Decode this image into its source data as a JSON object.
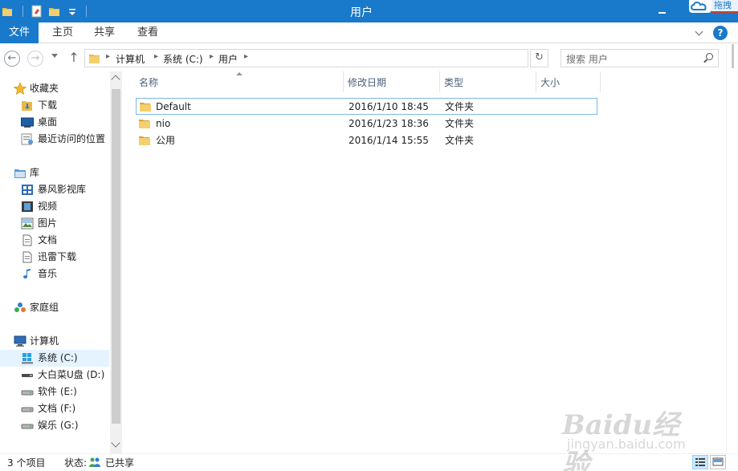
{
  "window": {
    "title": "用户",
    "overlay_button": "拖拽"
  },
  "ribbon": {
    "tabs": [
      "文件",
      "主页",
      "共享",
      "查看"
    ],
    "help": "?"
  },
  "nav": {
    "breadcrumb": [
      "计算机",
      "系统 (C:)",
      "用户"
    ],
    "search_placeholder": "搜索 用户"
  },
  "sidebar": {
    "favorites_header": "收藏夹",
    "favorites": [
      "下载",
      "桌面",
      "最近访问的位置"
    ],
    "libraries_header": "库",
    "libraries": [
      "暴风影视库",
      "视频",
      "图片",
      "文档",
      "迅雷下载",
      "音乐"
    ],
    "homegroup": "家庭组",
    "computer_header": "计算机",
    "drives": [
      "系统 (C:)",
      "大白菜U盘 (D:)",
      "软件 (E:)",
      "文档 (F:)",
      "娱乐 (G:)"
    ]
  },
  "columns": [
    "名称",
    "修改日期",
    "类型",
    "大小"
  ],
  "files": [
    {
      "name": "Default",
      "date": "2016/1/10 18:45",
      "type": "文件夹",
      "size": ""
    },
    {
      "name": "nio",
      "date": "2016/1/23 18:36",
      "type": "文件夹",
      "size": ""
    },
    {
      "name": "公用",
      "date": "2016/1/14 15:55",
      "type": "文件夹",
      "size": ""
    }
  ],
  "status": {
    "count": "3 个项目",
    "state_label": "状态:",
    "shared": "已共享"
  },
  "watermark": {
    "main": "Baidu经验",
    "sub": "jingyan.baidu.com"
  },
  "colors": {
    "accent": "#1979ca",
    "folder": "#e8b84a",
    "selection": "#e5f3ff"
  }
}
